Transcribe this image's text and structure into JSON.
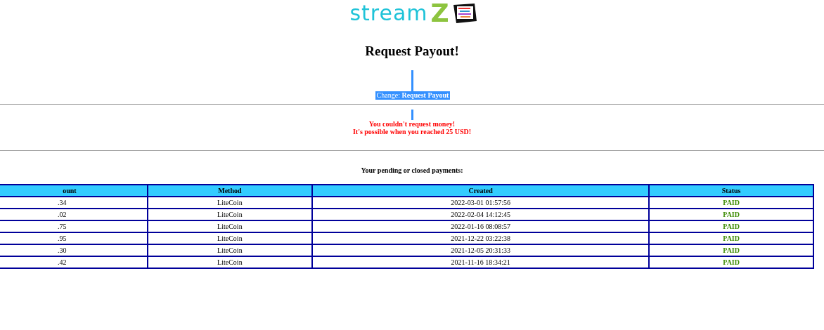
{
  "logo": {
    "word": "stream",
    "letter": "Z"
  },
  "title": "Request Payout!",
  "change_link": "Change: **Request Payout**",
  "messages": [
    "You couldn't request money!",
    "It's possible when you reached 25 USD!"
  ],
  "payments_heading": "Your pending or closed payments:",
  "table": {
    "columns": [
      "ount",
      "Method",
      "Created",
      "Status"
    ],
    "rows": [
      [
        ".34",
        "LiteCoin",
        "2022-03-01 01:57:56",
        "PAID"
      ],
      [
        ".02",
        "LiteCoin",
        "2022-02-04 14:12:45",
        "PAID"
      ],
      [
        ".75",
        "LiteCoin",
        "2022-01-16 08:08:57",
        "PAID"
      ],
      [
        ".95",
        "LiteCoin",
        "2021-12-22 03:22:38",
        "PAID"
      ],
      [
        ".30",
        "LiteCoin",
        "2021-12-05 20:31:33",
        "PAID"
      ],
      [
        ".42",
        "LiteCoin",
        "2021-11-16 18:34:21",
        "PAID"
      ]
    ]
  }
}
